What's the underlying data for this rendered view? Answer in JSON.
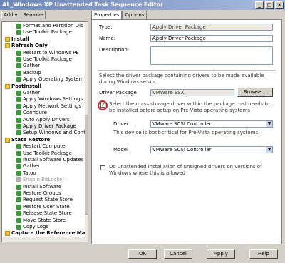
{
  "window": {
    "title": "AL_Windows XP Unattended Task Sequence Editor"
  },
  "toolbar": {
    "add": "Add ▾",
    "remove": "Remove"
  },
  "tree": [
    {
      "label": "Format and Partition Dis",
      "type": "ok"
    },
    {
      "label": "Use Toolkit Package",
      "type": "ok"
    },
    {
      "label": "Install",
      "type": "group"
    },
    {
      "label": "Refresh Only",
      "type": "group"
    },
    {
      "label": "Restart to Windows PE",
      "type": "ok"
    },
    {
      "label": "Use Toolkit Package",
      "type": "ok"
    },
    {
      "label": "Gather",
      "type": "ok"
    },
    {
      "label": "Backup",
      "type": "ok"
    },
    {
      "label": "Apply Operating System Ima",
      "type": "ok"
    },
    {
      "label": "PostInstall",
      "type": "group"
    },
    {
      "label": "Gather",
      "type": "ok"
    },
    {
      "label": "Apply Windows Settings",
      "type": "ok"
    },
    {
      "label": "Apply Network Settings",
      "type": "ok"
    },
    {
      "label": "Configure",
      "type": "ok"
    },
    {
      "label": "Auto Apply Drivers",
      "type": "ok"
    },
    {
      "label": "Apply Driver Package",
      "type": "ok",
      "selected": true
    },
    {
      "label": "Setup Windows and ConfigM",
      "type": "ok"
    },
    {
      "label": "State Restore",
      "type": "group"
    },
    {
      "label": "Restart Computer",
      "type": "ok"
    },
    {
      "label": "Use Toolkit Package",
      "type": "ok"
    },
    {
      "label": "Install Software Updates",
      "type": "ok"
    },
    {
      "label": "Gather",
      "type": "ok"
    },
    {
      "label": "Tatoo",
      "type": "ok"
    },
    {
      "label": "Enable BitLocker",
      "type": "disabled"
    },
    {
      "label": "Install Software",
      "type": "ok"
    },
    {
      "label": "Restore Groups",
      "type": "ok"
    },
    {
      "label": "Request State Store",
      "type": "ok"
    },
    {
      "label": "Restore User State",
      "type": "ok"
    },
    {
      "label": "Release State Store",
      "type": "ok"
    },
    {
      "label": "Move State Store",
      "type": "ok"
    },
    {
      "label": "Copy Logs",
      "type": "ok"
    },
    {
      "label": "Capture the Reference Mac",
      "type": "group"
    }
  ],
  "tabs": [
    "Properties",
    "Options"
  ],
  "properties": {
    "type_label": "Type:",
    "type_value": "Apply Driver Package",
    "name_label": "Name:",
    "name_value": "Apply Driver Package",
    "description_label": "Description:",
    "select_text": "Select the driver package containing drivers to be made available during Windows setup.",
    "driver_package_label": "Driver Package",
    "driver_package_value": "VMWare ESX",
    "browse_label": "Browse...",
    "mass_storage_text": "Select the mass storage driver within the package that needs to be installed before setup on Pre-Vista operating systems",
    "mass_storage_checked": "✔",
    "driver_label": "Driver",
    "driver_value": "VMware SCSI Controller",
    "boot_critical_text": "This device is boot-critical for Pre-Vista operating systems.",
    "model_label": "Model",
    "model_value": "VMware SCSI Controller",
    "unattended_text": "Do unattended installation of unsigned drivers on versions of Windows where this is allowed"
  },
  "buttons": {
    "ok": "OK",
    "cancel": "Cancel",
    "apply": "Apply",
    "help": "Help"
  }
}
